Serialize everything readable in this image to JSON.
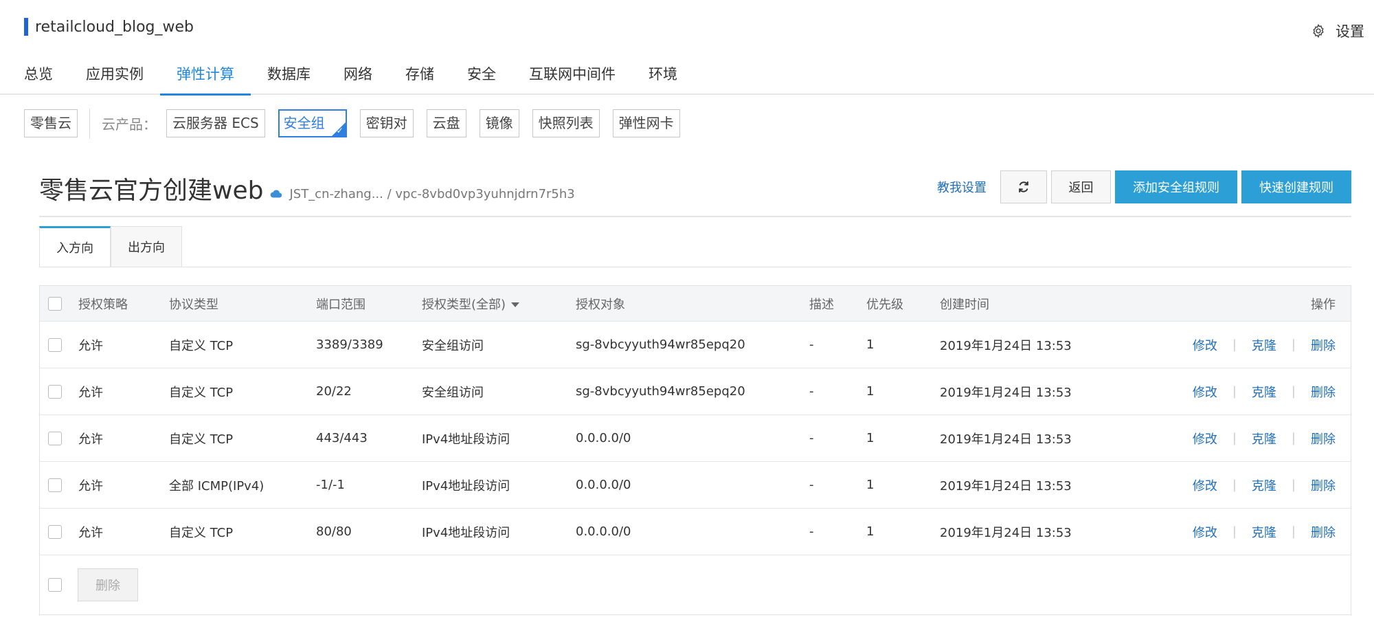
{
  "app": {
    "title": "retailcloud_blog_web",
    "settings_label": "设置"
  },
  "top_tabs": [
    {
      "label": "总览"
    },
    {
      "label": "应用实例"
    },
    {
      "label": "弹性计算"
    },
    {
      "label": "数据库"
    },
    {
      "label": "网络"
    },
    {
      "label": "存储"
    },
    {
      "label": "安全"
    },
    {
      "label": "互联网中间件"
    },
    {
      "label": "环境"
    }
  ],
  "active_top_tab": "弹性计算",
  "product_bar": {
    "home_chip": "零售云",
    "label": "云产品：",
    "products": [
      "云服务器 ECS",
      "安全组",
      "密钥对",
      "云盘",
      "镜像",
      "快照列表",
      "弹性网卡"
    ],
    "active": "安全组"
  },
  "page": {
    "title": "零售云官方创建web",
    "breadcrumb": "JST_cn-zhang... / vpc-8vbd0vp3yuhnjdrn7r5h3",
    "help_link": "教我设置",
    "back_label": "返回",
    "add_rule_label": "添加安全组规则",
    "quick_create_label": "快速创建规则"
  },
  "direction_tabs": {
    "inbound": "入方向",
    "outbound": "出方向",
    "active": "入方向"
  },
  "table": {
    "headers": {
      "policy": "授权策略",
      "protocol": "协议类型",
      "port": "端口范围",
      "auth_type": "授权类型(全部)",
      "object": "授权对象",
      "desc": "描述",
      "priority": "优先级",
      "created": "创建时间",
      "ops": "操作"
    },
    "rows": [
      {
        "policy": "允许",
        "protocol": "自定义 TCP",
        "port": "3389/3389",
        "auth_type": "安全组访问",
        "object": "sg-8vbcyyuth94wr85epq20",
        "desc": "-",
        "priority": "1",
        "created": "2019年1月24日 13:53"
      },
      {
        "policy": "允许",
        "protocol": "自定义 TCP",
        "port": "20/22",
        "auth_type": "安全组访问",
        "object": "sg-8vbcyyuth94wr85epq20",
        "desc": "-",
        "priority": "1",
        "created": "2019年1月24日 13:53"
      },
      {
        "policy": "允许",
        "protocol": "自定义 TCP",
        "port": "443/443",
        "auth_type": "IPv4地址段访问",
        "object": "0.0.0.0/0",
        "desc": "-",
        "priority": "1",
        "created": "2019年1月24日 13:53"
      },
      {
        "policy": "允许",
        "protocol": "全部 ICMP(IPv4)",
        "port": "-1/-1",
        "auth_type": "IPv4地址段访问",
        "object": "0.0.0.0/0",
        "desc": "-",
        "priority": "1",
        "created": "2019年1月24日 13:53"
      },
      {
        "policy": "允许",
        "protocol": "自定义 TCP",
        "port": "80/80",
        "auth_type": "IPv4地址段访问",
        "object": "0.0.0.0/0",
        "desc": "-",
        "priority": "1",
        "created": "2019年1月24日 13:53"
      }
    ],
    "row_ops": {
      "edit": "修改",
      "clone": "克隆",
      "delete": "删除"
    },
    "bulk_delete_label": "删除"
  },
  "icons": {
    "settings": "gear-icon",
    "refresh": "refresh-icon",
    "cloud": "cloud-icon",
    "sort": "caret-down-icon"
  },
  "colors": {
    "accent": "#1f87e0",
    "primary_button": "#2ca0d6",
    "link": "#1f6fbf"
  }
}
